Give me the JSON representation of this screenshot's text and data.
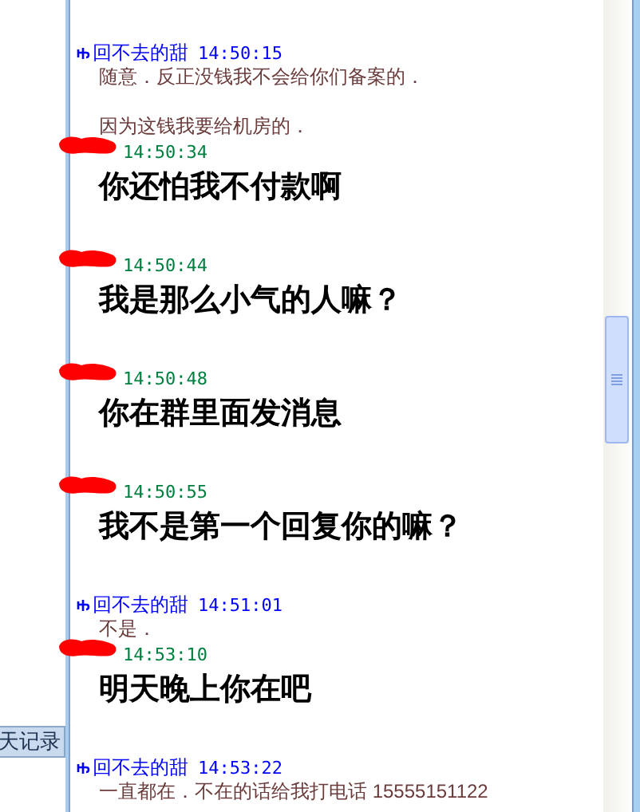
{
  "history_button": "天记录",
  "messages": [
    {
      "kind": "them",
      "has_icon": true,
      "sender": "回不去的甜",
      "time": "14:50:15",
      "lines": [
        "随意．反正没钱我不会给你们备案的．",
        "因为这钱我要给机房的．"
      ]
    },
    {
      "kind": "me",
      "time": "14:50:34",
      "lines": [
        "你还怕我不付款啊"
      ]
    },
    {
      "kind": "me",
      "time": "14:50:44",
      "lines": [
        "我是那么小气的人嘛？"
      ]
    },
    {
      "kind": "me",
      "time": "14:50:48",
      "lines": [
        "你在群里面发消息"
      ]
    },
    {
      "kind": "me",
      "time": "14:50:55",
      "lines": [
        "我不是第一个回复你的嘛？"
      ]
    },
    {
      "kind": "them",
      "has_icon": true,
      "sender": "回不去的甜",
      "time": "14:51:01",
      "lines": [
        "不是．"
      ]
    },
    {
      "kind": "me",
      "time": "14:53:10",
      "lines": [
        "明天晚上你在吧"
      ]
    },
    {
      "kind": "them",
      "has_icon": true,
      "sender": "回不去的甜",
      "time": "14:53:22",
      "lines": [
        "一直都在．不在的话给我打电话 15555151122"
      ]
    }
  ]
}
